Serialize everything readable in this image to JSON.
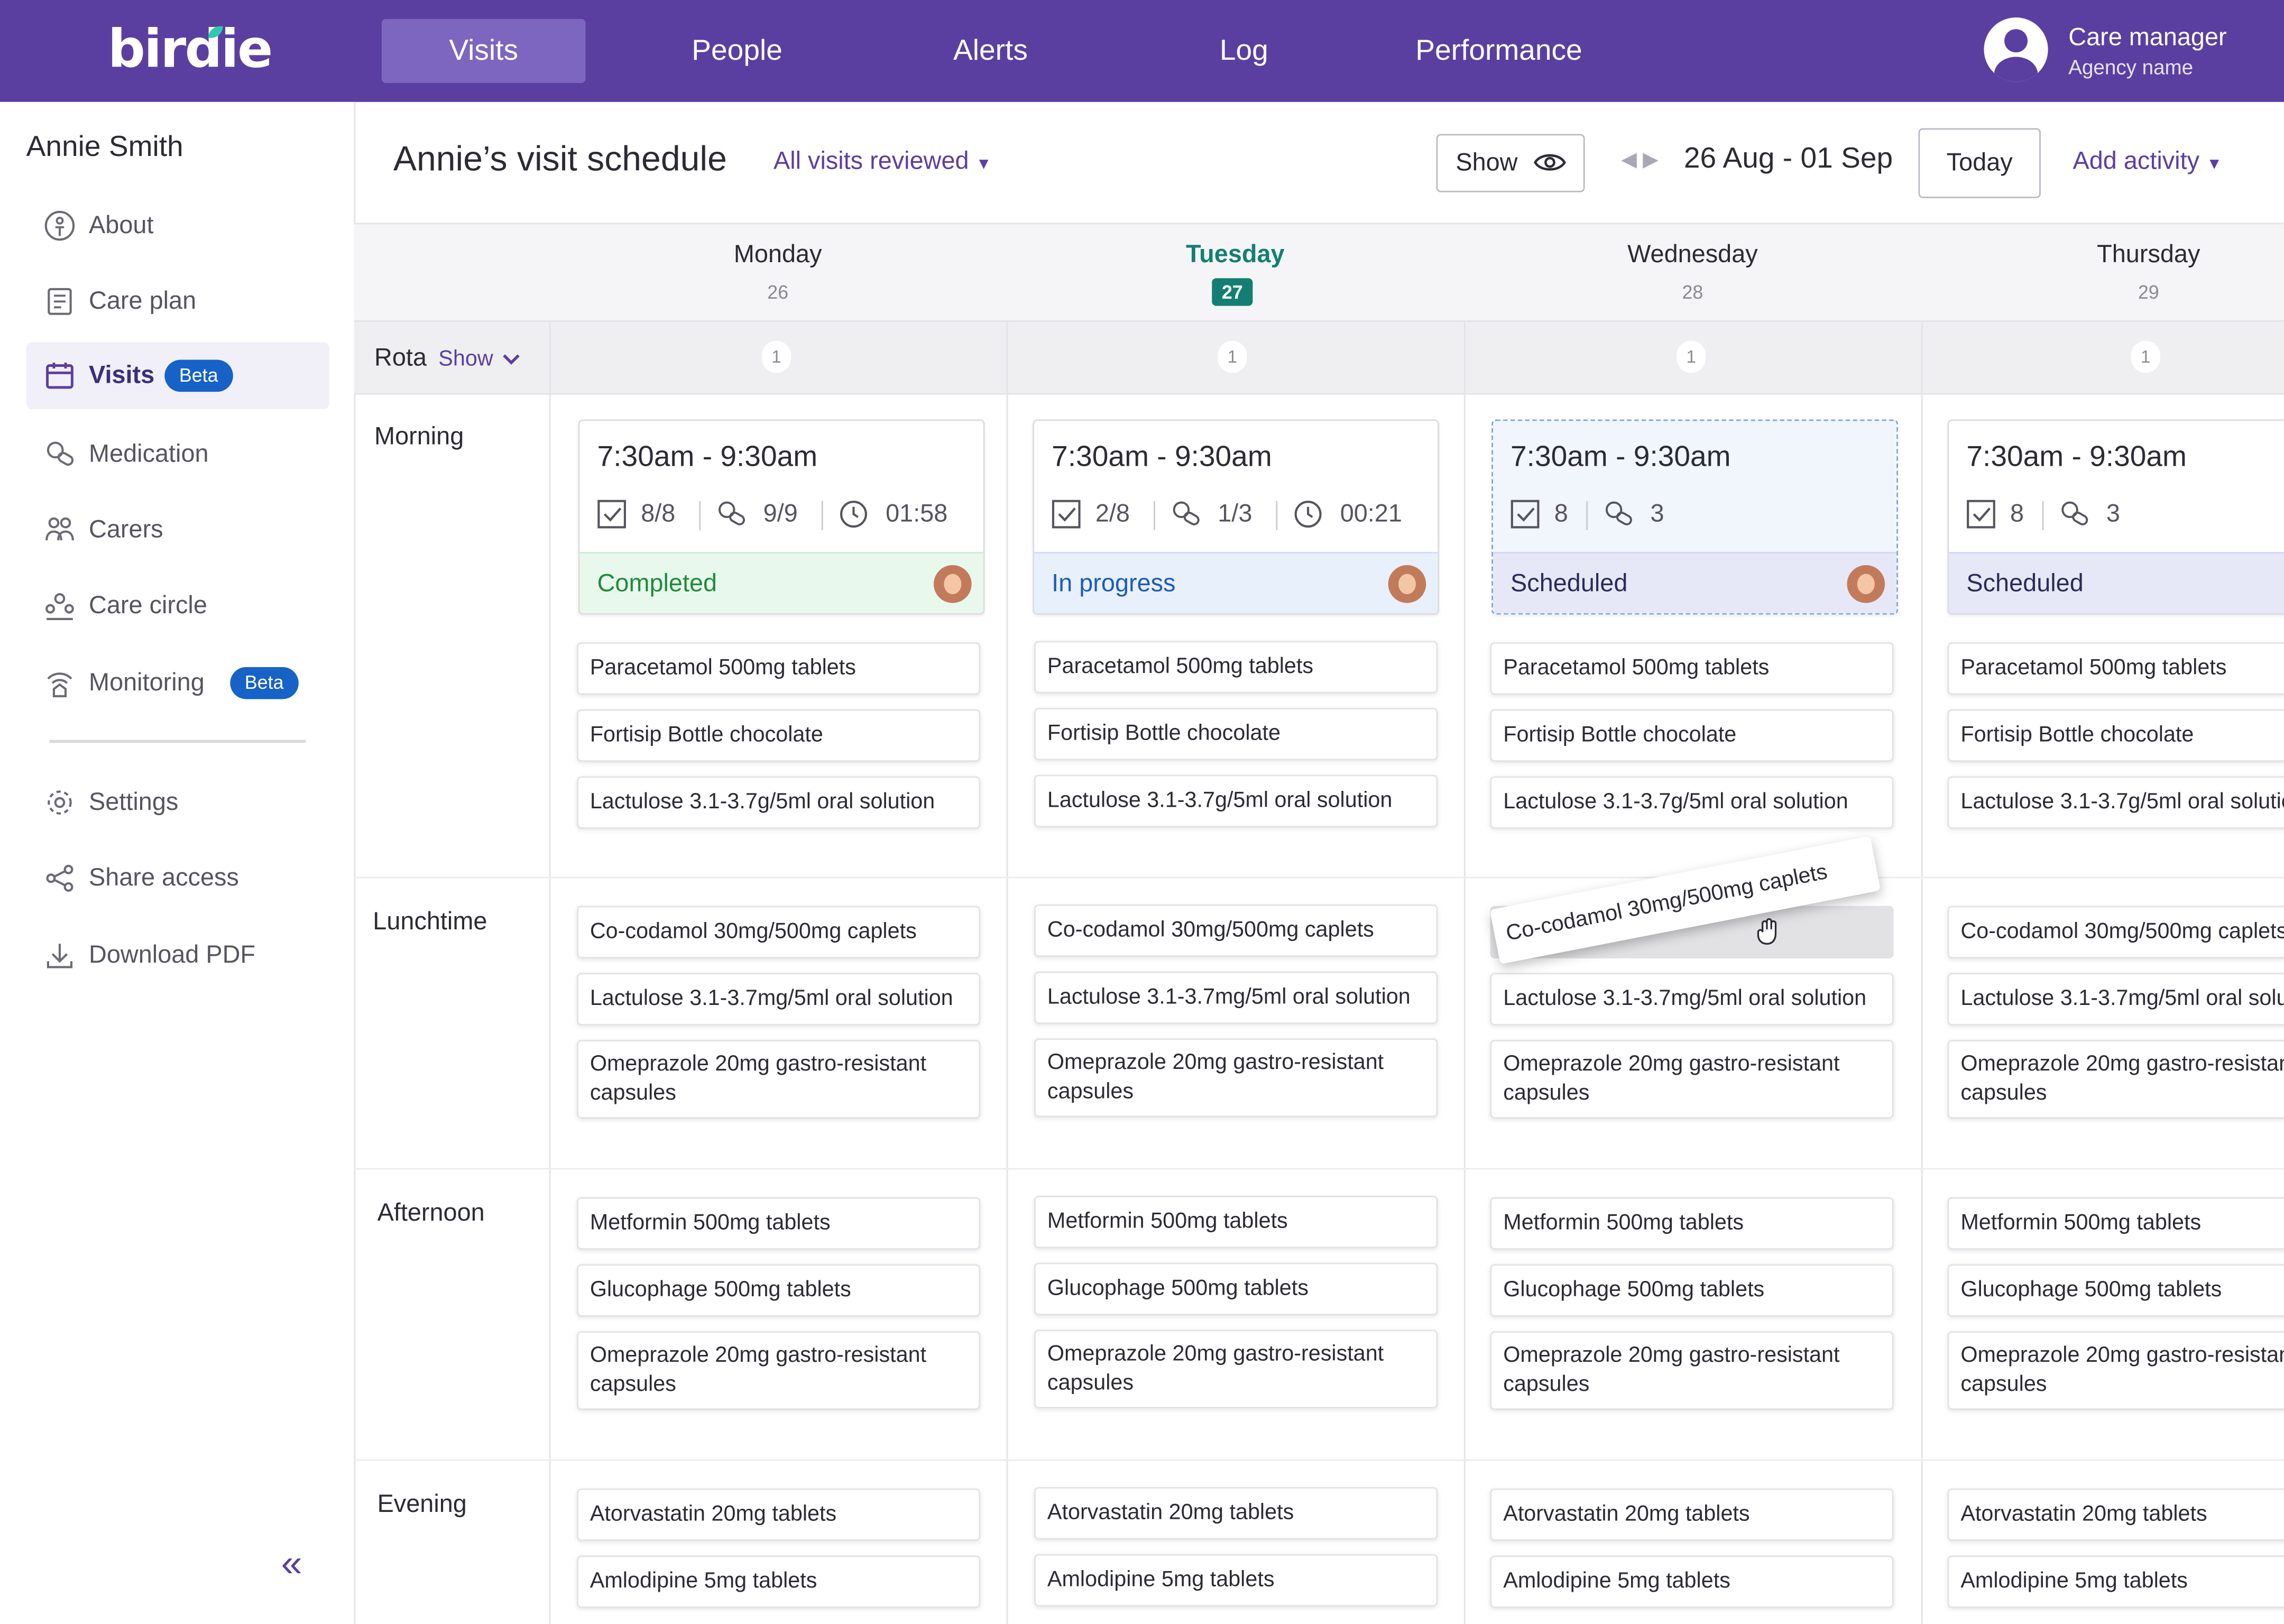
{
  "brand": {
    "logo_text": "birdie",
    "logo_accent": "#2fc9b0",
    "primary": "#5b3fa0"
  },
  "nav": {
    "items": [
      {
        "label": "Visits",
        "active": true
      },
      {
        "label": "People",
        "active": false
      },
      {
        "label": "Alerts",
        "active": false
      },
      {
        "label": "Log",
        "active": false
      },
      {
        "label": "Performance",
        "active": false
      }
    ]
  },
  "user": {
    "role": "Care manager",
    "agency": "Agency name",
    "icon": "user-avatar-icon"
  },
  "sidebar": {
    "patient_name": "Annie Smith",
    "items": [
      {
        "label": "About",
        "icon": "person-circle-icon"
      },
      {
        "label": "Care plan",
        "icon": "care-plan-icon"
      },
      {
        "label": "Visits",
        "icon": "calendar-icon",
        "badge": "Beta",
        "active": true
      },
      {
        "label": "Medication",
        "icon": "pills-icon"
      },
      {
        "label": "Carers",
        "icon": "carers-icon"
      },
      {
        "label": "Care circle",
        "icon": "care-circle-icon"
      },
      {
        "label": "Monitoring",
        "icon": "monitoring-icon",
        "badge": "Beta"
      },
      {
        "label": "Settings",
        "icon": "gear-icon"
      },
      {
        "label": "Share access",
        "icon": "share-icon"
      },
      {
        "label": "Download PDF",
        "icon": "download-icon"
      }
    ],
    "collapse_icon": "double-chevron-left-icon"
  },
  "header": {
    "title": "Annie’s visit schedule",
    "reviewed_filter": "All visits reviewed",
    "show_button": "Show",
    "date_range": "26 Aug - 01 Sep",
    "today_button": "Today",
    "add_activity": "Add activity"
  },
  "grid": {
    "days": [
      {
        "name": "Monday",
        "date": "26",
        "today": false,
        "rota_count": "1"
      },
      {
        "name": "Tuesday",
        "date": "27",
        "today": true,
        "rota_count": "1"
      },
      {
        "name": "Wednesday",
        "date": "28",
        "today": false,
        "rota_count": "1"
      },
      {
        "name": "Thursday",
        "date": "29",
        "today": false,
        "rota_count": "1"
      }
    ],
    "rota_label": "Rota",
    "rota_show": "Show",
    "slots": [
      "Morning",
      "Lunchtime",
      "Afternoon",
      "Evening"
    ]
  },
  "visits": [
    {
      "time": "7:30am - 9:30am",
      "tasks": "8/8",
      "meds": "9/9",
      "duration": "01:58",
      "status": "Completed"
    },
    {
      "time": "7:30am - 9:30am",
      "tasks": "2/8",
      "meds": "1/3",
      "duration": "00:21",
      "status": "In progress"
    },
    {
      "time": "7:30am - 9:30am",
      "tasks": "8",
      "meds": "3",
      "status": "Scheduled"
    },
    {
      "time": "7:30am - 9:30am",
      "tasks": "8",
      "meds": "3",
      "status": "Scheduled"
    }
  ],
  "meds": {
    "morning": [
      "Paracetamol 500mg tablets",
      "Fortisip Bottle chocolate",
      "Lactulose 3.1-3.7g/5ml oral solution"
    ],
    "lunchtime": [
      "Co-codamol 30mg/500mg caplets",
      "Lactulose 3.1-3.7mg/5ml oral solution",
      "Omeprazole 20mg gastro-resistant capsules"
    ],
    "afternoon": [
      "Metformin 500mg tablets",
      "Glucophage 500mg tablets",
      "Omeprazole 20mg gastro-resistant capsules"
    ],
    "evening": [
      "Atorvastatin 20mg tablets",
      "Amlodipine 5mg tablets"
    ]
  },
  "drag": {
    "label": "Co-codamol 30mg/500mg caplets",
    "partial_label": "...ulose 3.1-3.7mg/5ml oral solution"
  }
}
